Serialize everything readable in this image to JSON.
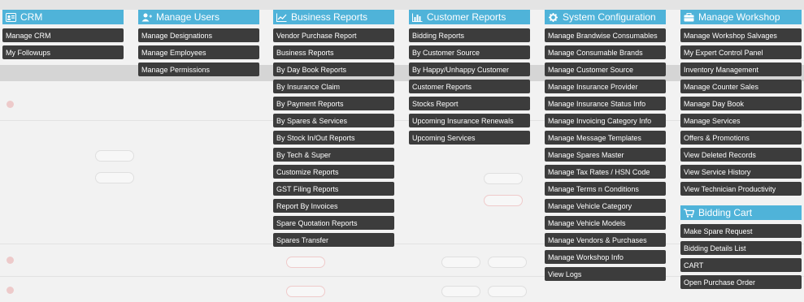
{
  "colors": {
    "header_bg": "#4fb3d9",
    "item_bg": "#3c3c3c",
    "item_text": "#ffffff",
    "page_bg": "#f2f2f2"
  },
  "menu": {
    "crm": {
      "title": "CRM",
      "icon": "id-card-icon",
      "items": [
        "Manage CRM",
        "My Followups"
      ]
    },
    "manage_users": {
      "title": "Manage Users",
      "icon": "user-plus-icon",
      "items": [
        "Manage Designations",
        "Manage Employees",
        "Manage Permissions"
      ]
    },
    "business_reports": {
      "title": "Business Reports",
      "icon": "line-chart-icon",
      "items": [
        "Vendor Purchase Report",
        "Business Reports",
        "By Day Book Reports",
        "By Insurance Claim",
        "By Payment Reports",
        "By Spares & Services",
        "By Stock In/Out Reports",
        "By Tech & Super",
        "Customize Reports",
        "GST Filing Reports",
        "Report By Invoices",
        "Spare Quotation Reports",
        "Spares Transfer"
      ]
    },
    "customer_reports": {
      "title": "Customer Reports",
      "icon": "bar-chart-icon",
      "items": [
        "Bidding Reports",
        "By Customer Source",
        "By Happy/Unhappy Customer",
        "Customer Reports",
        "Stocks Report",
        "Upcoming Insurance Renewals",
        "Upcoming Services"
      ]
    },
    "system_configuration": {
      "title": "System Configuration",
      "icon": "gear-icon",
      "items": [
        "Manage Brandwise Consumables",
        "Manage Consumable Brands",
        "Manage Customer Source",
        "Manage Insurance Provider",
        "Manage Insurance Status Info",
        "Manage Invoicing Category Info",
        "Manage Message Templates",
        "Manage Spares Master",
        "Manage Tax Rates / HSN Code",
        "Manage Terms n Conditions",
        "Manage Vehicle Category",
        "Manage Vehicle Models",
        "Manage Vendors & Purchases",
        "Manage Workshop Info",
        "View Logs"
      ]
    },
    "manage_workshop": {
      "title": "Manage Workshop",
      "icon": "briefcase-icon",
      "items": [
        "Manage Workshop Salvages",
        "My Expert Control Panel",
        "Inventory Management",
        "Manage Counter Sales",
        "Manage Day Book",
        "Manage Services",
        "Offers & Promotions",
        "View Deleted Records",
        "View Service History",
        "View Technician Productivity"
      ]
    },
    "bidding_cart": {
      "title": "Bidding Cart",
      "icon": "cart-icon",
      "items": [
        "Make Spare Request",
        "Bidding Details List",
        "CART",
        "Open Purchase Order"
      ]
    }
  }
}
